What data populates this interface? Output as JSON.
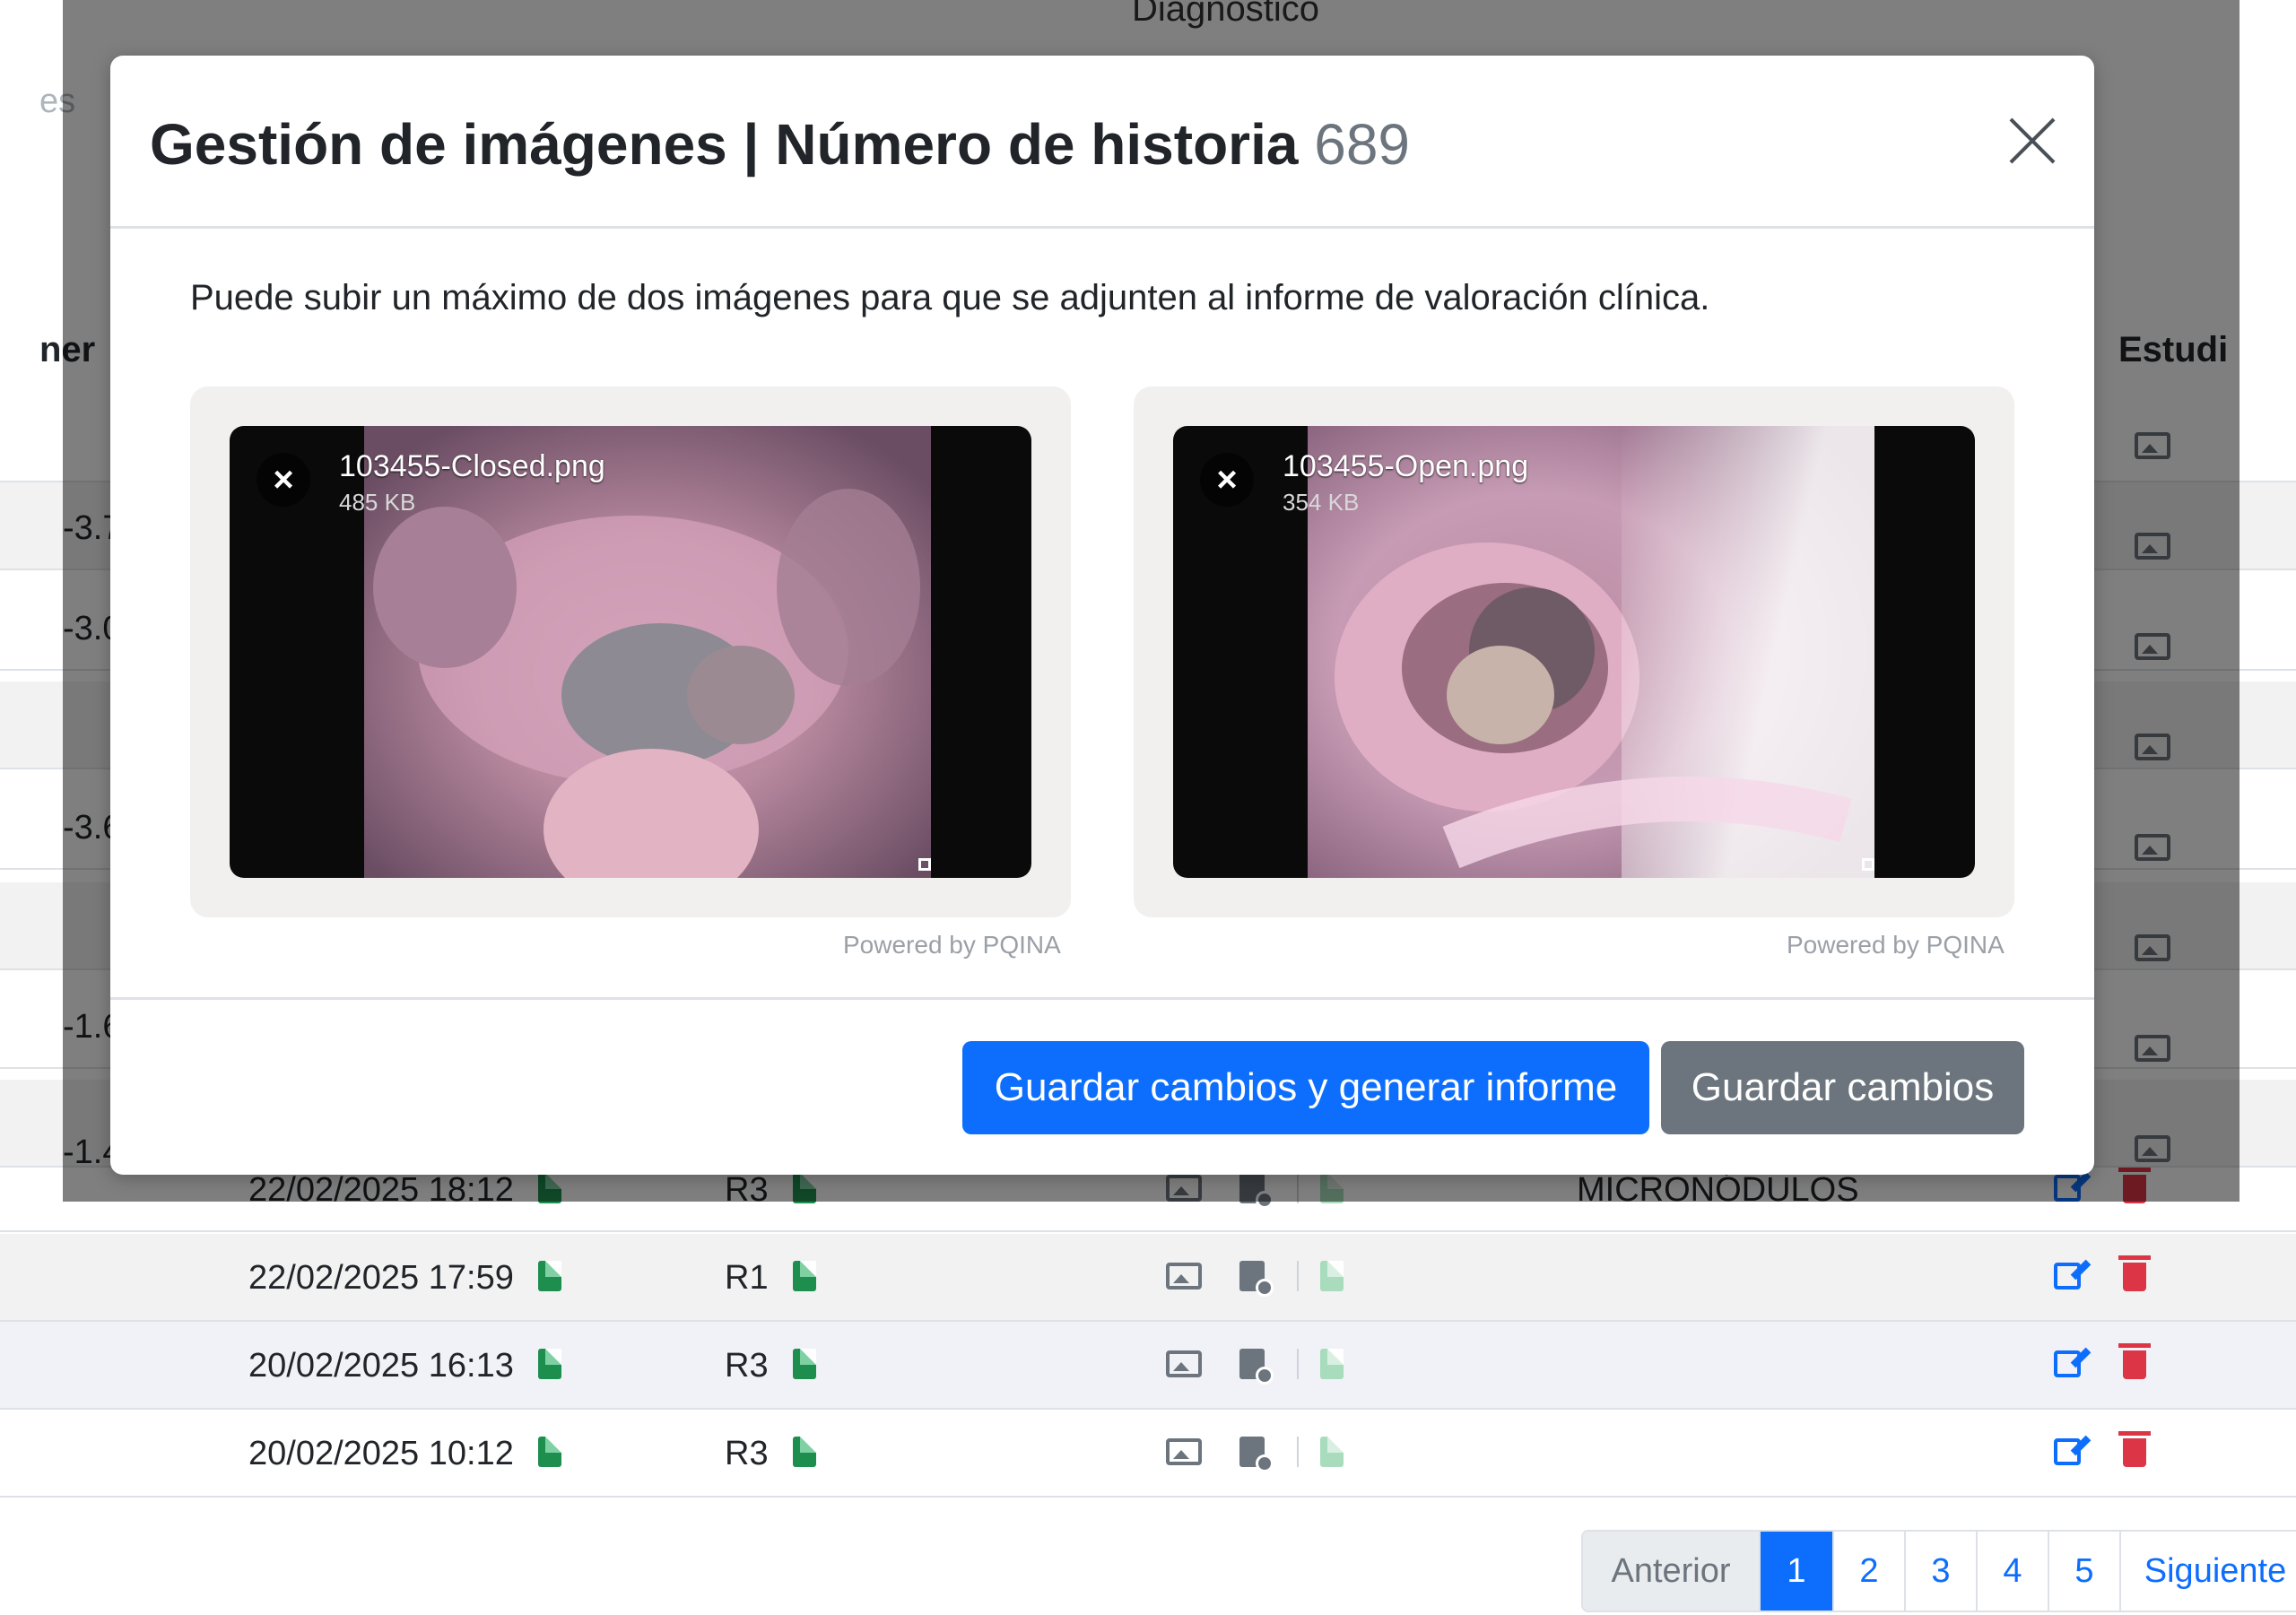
{
  "background": {
    "header_label": "Diagnóstico",
    "fragment_left": "es",
    "col_fragment_left": "ner",
    "col_fragment_right": "Estudi",
    "hidden_row_values": [
      "-3.7",
      "-3.0",
      "-3.6",
      "-1.6",
      "-1.4"
    ],
    "partial_row": {
      "date": "22/02/2025 18:12",
      "grade": "R3",
      "diagnosis": "MICRONÓDULOS"
    },
    "rows": [
      {
        "date": "22/02/2025 17:59",
        "grade": "R1"
      },
      {
        "date": "20/02/2025 16:13",
        "grade": "R3"
      },
      {
        "date": "20/02/2025 10:12",
        "grade": "R3"
      }
    ]
  },
  "pagination": {
    "prev": "Anterior",
    "pages": [
      "1",
      "2",
      "3",
      "4",
      "5"
    ],
    "active_page": "1",
    "next": "Siguiente"
  },
  "modal": {
    "title": "Gestión de imágenes | Número de historia",
    "history_number": "689",
    "intro": "Puede subir un máximo de dos imágenes para que se adjunten al informe de valoración clínica.",
    "images": [
      {
        "filename": "103455-Closed.png",
        "size": "485 KB",
        "powered": "Powered by PQINA"
      },
      {
        "filename": "103455-Open.png",
        "size": "354 KB",
        "powered": "Powered by PQINA"
      }
    ],
    "remove_symbol": "×",
    "buttons": {
      "save_and_generate": "Guardar cambios y generar informe",
      "save": "Guardar cambios"
    }
  },
  "colors": {
    "primary": "#0d6efd",
    "secondary": "#6c757d",
    "danger": "#dc3545",
    "excel_green": "#1e8e4f"
  },
  "icons": [
    "close-icon",
    "image-icon",
    "file-gear-icon",
    "excel-icon",
    "edit-icon",
    "trash-icon",
    "remove-image-icon"
  ]
}
